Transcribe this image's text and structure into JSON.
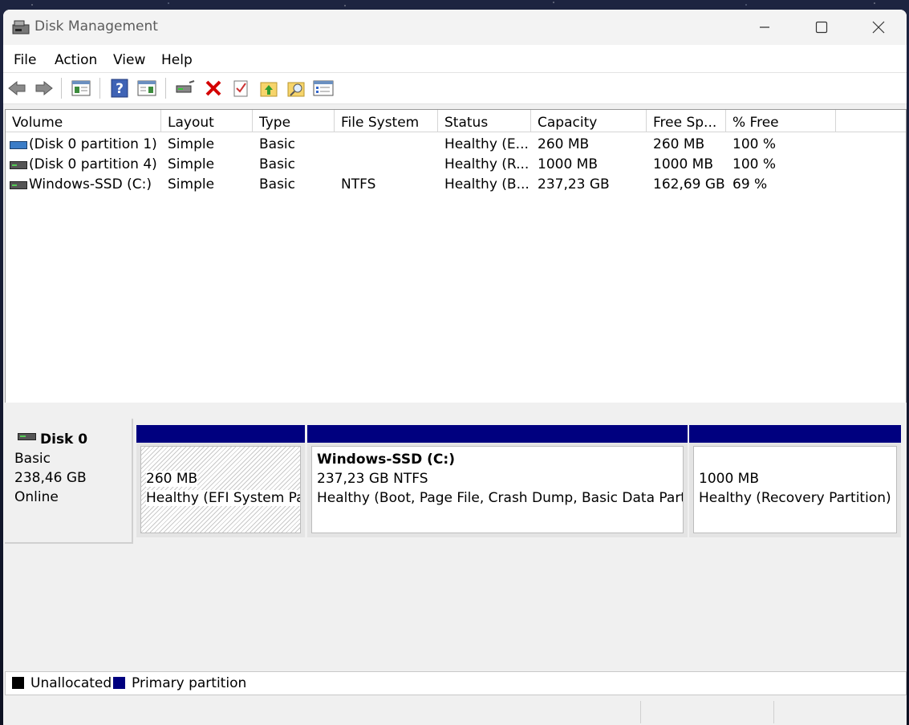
{
  "window": {
    "title": "Disk Management"
  },
  "menu": [
    "File",
    "Action",
    "View",
    "Help"
  ],
  "toolbar": {
    "icons": [
      "back-arrow-icon",
      "forward-arrow-icon",
      "console-tree-icon",
      "help-icon",
      "action-pane-icon",
      "connect-drive-icon",
      "delete-icon",
      "checklist-icon",
      "folder-up-icon",
      "search-folder-icon",
      "properties-icon"
    ]
  },
  "columns": [
    "Volume",
    "Layout",
    "Type",
    "File System",
    "Status",
    "Capacity",
    "Free Sp...",
    "% Free"
  ],
  "volumes": [
    {
      "volume": "(Disk 0 partition 1)",
      "layout": "Simple",
      "type": "Basic",
      "fs": "",
      "status": "Healthy (E...",
      "capacity": "260 MB",
      "free": "260 MB",
      "pct": "100 %"
    },
    {
      "volume": "(Disk 0 partition 4)",
      "layout": "Simple",
      "type": "Basic",
      "fs": "",
      "status": "Healthy (R...",
      "capacity": "1000 MB",
      "free": "1000 MB",
      "pct": "100 %"
    },
    {
      "volume": "Windows-SSD (C:)",
      "layout": "Simple",
      "type": "Basic",
      "fs": "NTFS",
      "status": "Healthy (B...",
      "capacity": "237,23 GB",
      "free": "162,69 GB",
      "pct": "69 %"
    }
  ],
  "disk": {
    "name": "Disk 0",
    "type": "Basic",
    "size": "238,46 GB",
    "state": "Online"
  },
  "partitions": [
    {
      "title": "",
      "size": "260 MB",
      "status": "Healthy (EFI System Par"
    },
    {
      "title": "Windows-SSD  (C:)",
      "size": "237,23 GB NTFS",
      "status": "Healthy (Boot, Page File, Crash Dump, Basic Data Partitio"
    },
    {
      "title": "",
      "size": "1000 MB",
      "status": "Healthy (Recovery Partition)"
    }
  ],
  "legend": {
    "unallocated": "Unallocated",
    "primary": "Primary partition"
  },
  "colors": {
    "primary": "#00007f",
    "unallocated": "#000000"
  }
}
